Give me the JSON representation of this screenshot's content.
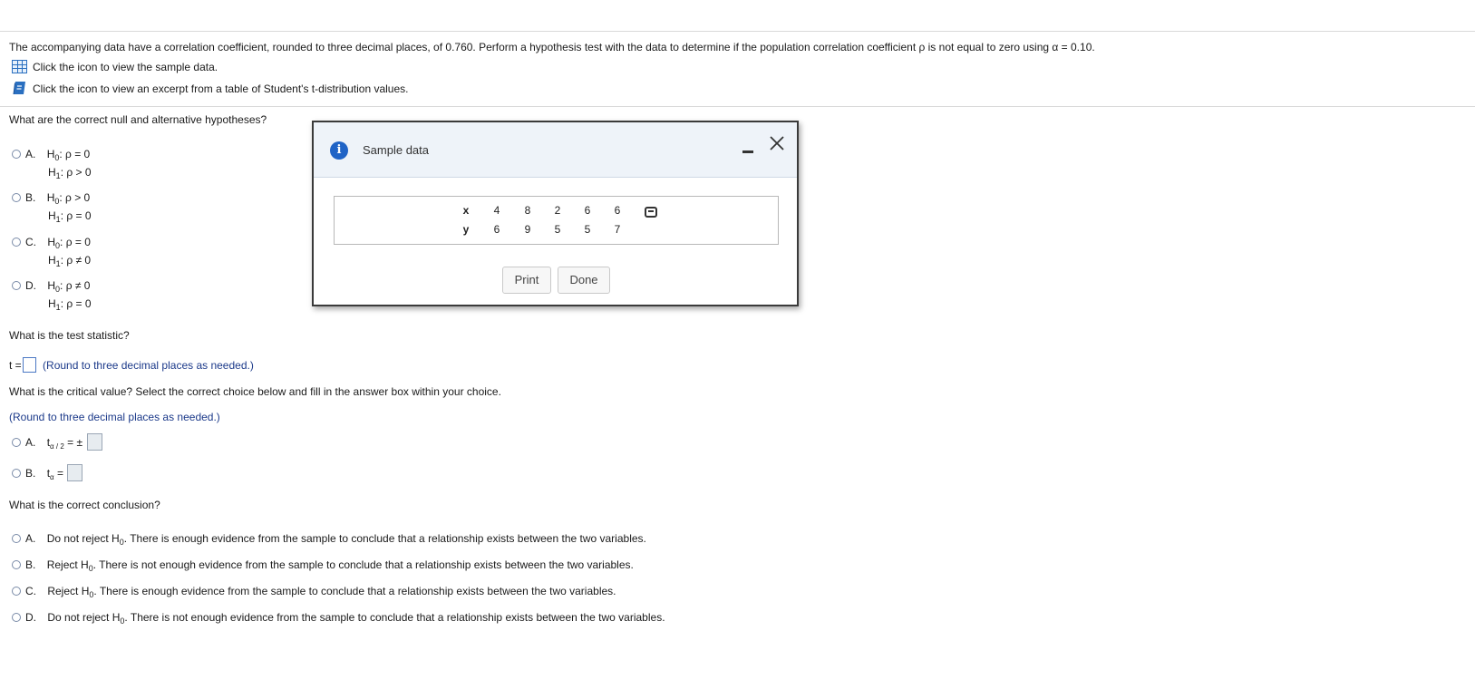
{
  "problem": {
    "intro": "The accompanying data have a correlation coefficient, rounded to three decimal places, of 0.760. Perform a hypothesis test with the data to determine if the population correlation coefficient ρ is not equal to zero using α = 0.10.",
    "link_sample": "Click the icon to view the sample data.",
    "link_table": "Click the icon to view an excerpt from a table of Student's t-distribution values."
  },
  "q1": {
    "prompt": "What are the correct null and alternative hypotheses?",
    "options": [
      {
        "letter": "A.",
        "h0_rel": ": ρ = 0",
        "h1_rel": ": ρ > 0"
      },
      {
        "letter": "B.",
        "h0_rel": ": ρ > 0",
        "h1_rel": ": ρ = 0"
      },
      {
        "letter": "C.",
        "h0_rel": ": ρ = 0",
        "h1_rel": ": ρ ≠ 0"
      },
      {
        "letter": "D.",
        "h0_rel": ": ρ ≠ 0",
        "h1_rel": ": ρ = 0"
      }
    ]
  },
  "q2": {
    "prompt": "What is the test statistic?",
    "prefix": "t =",
    "hint": "(Round to three decimal places as needed.)"
  },
  "q3": {
    "prompt": "What is the critical value? Select the correct choice below and fill in the answer box within your choice.",
    "hint": "(Round to three decimal places as needed.)",
    "option_a_letter": "A.",
    "option_a_sub": "α / 2",
    "option_a_eq": "= ±",
    "option_b_letter": "B.",
    "option_b_sub": "α",
    "option_b_eq": "="
  },
  "q4": {
    "prompt": "What is the correct conclusion?",
    "options": [
      {
        "letter": "A.",
        "action": "Do not reject H",
        "rest": ". There is enough evidence from the sample to conclude that a relationship exists between the two variables."
      },
      {
        "letter": "B.",
        "action": "Reject H",
        "rest": ". There is not enough evidence from the sample to conclude that a relationship exists between the two variables."
      },
      {
        "letter": "C.",
        "action": "Reject H",
        "rest": ". There is enough evidence from the sample to conclude that a relationship exists between the two variables."
      },
      {
        "letter": "D.",
        "action": "Do not reject H",
        "rest": ". There is not enough evidence from the sample to conclude that a relationship exists between the two variables."
      }
    ]
  },
  "symbols": {
    "H": "H",
    "sub0": "0",
    "sub1": "1",
    "t": "t"
  },
  "modal": {
    "title": "Sample data",
    "x_label": "x",
    "y_label": "y",
    "x_values": [
      "4",
      "8",
      "2",
      "6",
      "6"
    ],
    "y_values": [
      "6",
      "9",
      "5",
      "5",
      "7"
    ],
    "print_label": "Print",
    "done_label": "Done"
  },
  "icons": {
    "table_icon": "table-icon",
    "book_icon": "book-icon",
    "info_icon": "info-icon",
    "minimize_icon": "minimize-icon",
    "close_icon": "close-icon",
    "copy_icon": "copy-data-icon"
  },
  "colors": {
    "hint_blue": "#1c3a8a",
    "accent_blue": "#1f63c6"
  }
}
